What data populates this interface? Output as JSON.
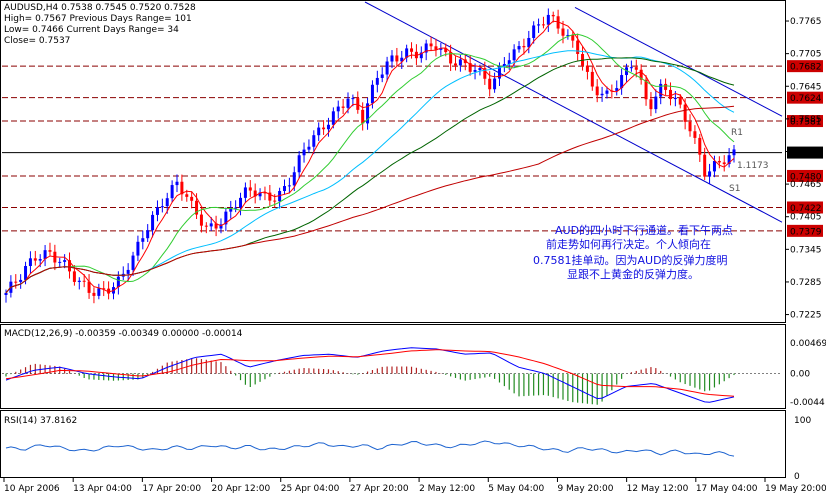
{
  "header": {
    "symbol_line": "AUDUSD,H4  0.7538 0.7545 0.7520 0.7528",
    "high_line": "High= 0.7567   Previous Days Range= 101",
    "low_line": "Low= 0.7466   Current Days Range= 34",
    "close_line": "Close= 0.7537"
  },
  "annotation": {
    "lines": [
      "AUD的四小时下行通道。看下午两点",
      "前走势如何再行决定。个人倾向在",
      "0.7581挂单动。因为AUD的反弹力度明",
      "显跟不上黄金的反弹力度。"
    ],
    "color": "#1010e0"
  },
  "chart_labels": {
    "r1": "R1",
    "s1": "S1",
    "pivot": "1.1173"
  },
  "colors": {
    "up": "#0000ff",
    "down": "#ff0000",
    "ma_red": "#ff0000",
    "ma_green": "#32cd32",
    "ma_cyan": "#00bfff",
    "ma_dark": "#006400",
    "ma_long": "#c00000",
    "channel": "#0000cc",
    "level_line": "#8b0000",
    "level_box": "#cc0000",
    "macd_line": "#0000ff",
    "signal_line": "#ff0000",
    "rsi_line": "#1e64d0",
    "macd_hist_up": "#b22222",
    "macd_hist_down": "#228b22"
  },
  "chart_data": [
    {
      "type": "candlestick",
      "title": "AUDUSD,H4",
      "x_tick_labels": [
        "10 Apr 2006",
        "13 Apr 04:00",
        "17 Apr 20:00",
        "20 Apr 12:00",
        "25 Apr 04:00",
        "27 Apr 20:00",
        "2 May 12:00",
        "5 May 04:00",
        "9 May 20:00",
        "12 May 12:00",
        "17 May 04:00",
        "19 May 20:00"
      ],
      "y_tick_labels": [
        "0.7765",
        "0.7705",
        "0.7645",
        "0.7585",
        "0.7525",
        "0.7465",
        "0.7405",
        "0.7345",
        "0.7285",
        "0.7225"
      ],
      "ylim": [
        0.7215,
        0.78
      ],
      "horizontal_levels": [
        0.7682,
        0.7624,
        0.7581,
        0.7523,
        0.748,
        0.7422,
        0.7379
      ],
      "current_price": 0.7523,
      "grid": false,
      "close_path": [
        0.7265,
        0.729,
        0.733,
        0.7345,
        0.732,
        0.728,
        0.7265,
        0.7275,
        0.729,
        0.733,
        0.739,
        0.744,
        0.747,
        0.742,
        0.738,
        0.74,
        0.743,
        0.745,
        0.744,
        0.7445,
        0.748,
        0.753,
        0.756,
        0.76,
        0.763,
        0.758,
        0.766,
        0.77,
        0.771,
        0.77,
        0.772,
        0.77,
        0.769,
        0.767,
        0.764,
        0.77,
        0.772,
        0.7745,
        0.777,
        0.775,
        0.772,
        0.764,
        0.762,
        0.766,
        0.77,
        0.76,
        0.764,
        0.762,
        0.757,
        0.748,
        0.75,
        0.7523
      ]
    },
    {
      "type": "line",
      "title": "MACD(12,26,9) -0.00359 -0.00349 0.00000 -0.00014",
      "y_tick_labels": [
        "0.00469",
        "0.00",
        "-0.0044"
      ],
      "ylim": [
        -0.005,
        0.0055
      ],
      "macd_path": [
        -0.001,
        0.0005,
        0.001,
        0.0,
        -0.0005,
        -0.0008,
        0.001,
        0.0025,
        0.003,
        0.001,
        0.002,
        0.0028,
        0.003,
        0.0025,
        0.0035,
        0.004,
        0.0038,
        0.003,
        0.0032,
        0.001,
        0.0,
        -0.002,
        -0.004,
        -0.002,
        -0.0015,
        -0.003,
        -0.0045,
        -0.0036
      ],
      "signal_path": [
        -0.0008,
        -0.0002,
        0.0005,
        0.0004,
        0.0,
        -0.0004,
        0.0002,
        0.0014,
        0.0022,
        0.002,
        0.002,
        0.0024,
        0.0027,
        0.0026,
        0.003,
        0.0035,
        0.0037,
        0.0035,
        0.0034,
        0.0026,
        0.0015,
        0.0,
        -0.0018,
        -0.002,
        -0.002,
        -0.0024,
        -0.0032,
        -0.0035
      ]
    },
    {
      "type": "line",
      "title": "RSI(14) 37.8162",
      "y_tick_labels": [
        "100",
        "0"
      ],
      "ylim": [
        0,
        100
      ],
      "rsi_path": [
        50,
        48,
        56,
        50,
        45,
        48,
        55,
        50,
        46,
        52,
        49,
        55,
        50,
        53,
        47,
        50,
        54,
        58,
        52,
        55,
        49,
        57,
        60,
        55,
        52,
        58,
        61,
        56,
        53,
        48,
        44,
        50,
        46,
        42,
        47,
        40,
        45,
        38,
        42,
        37.8
      ]
    }
  ]
}
